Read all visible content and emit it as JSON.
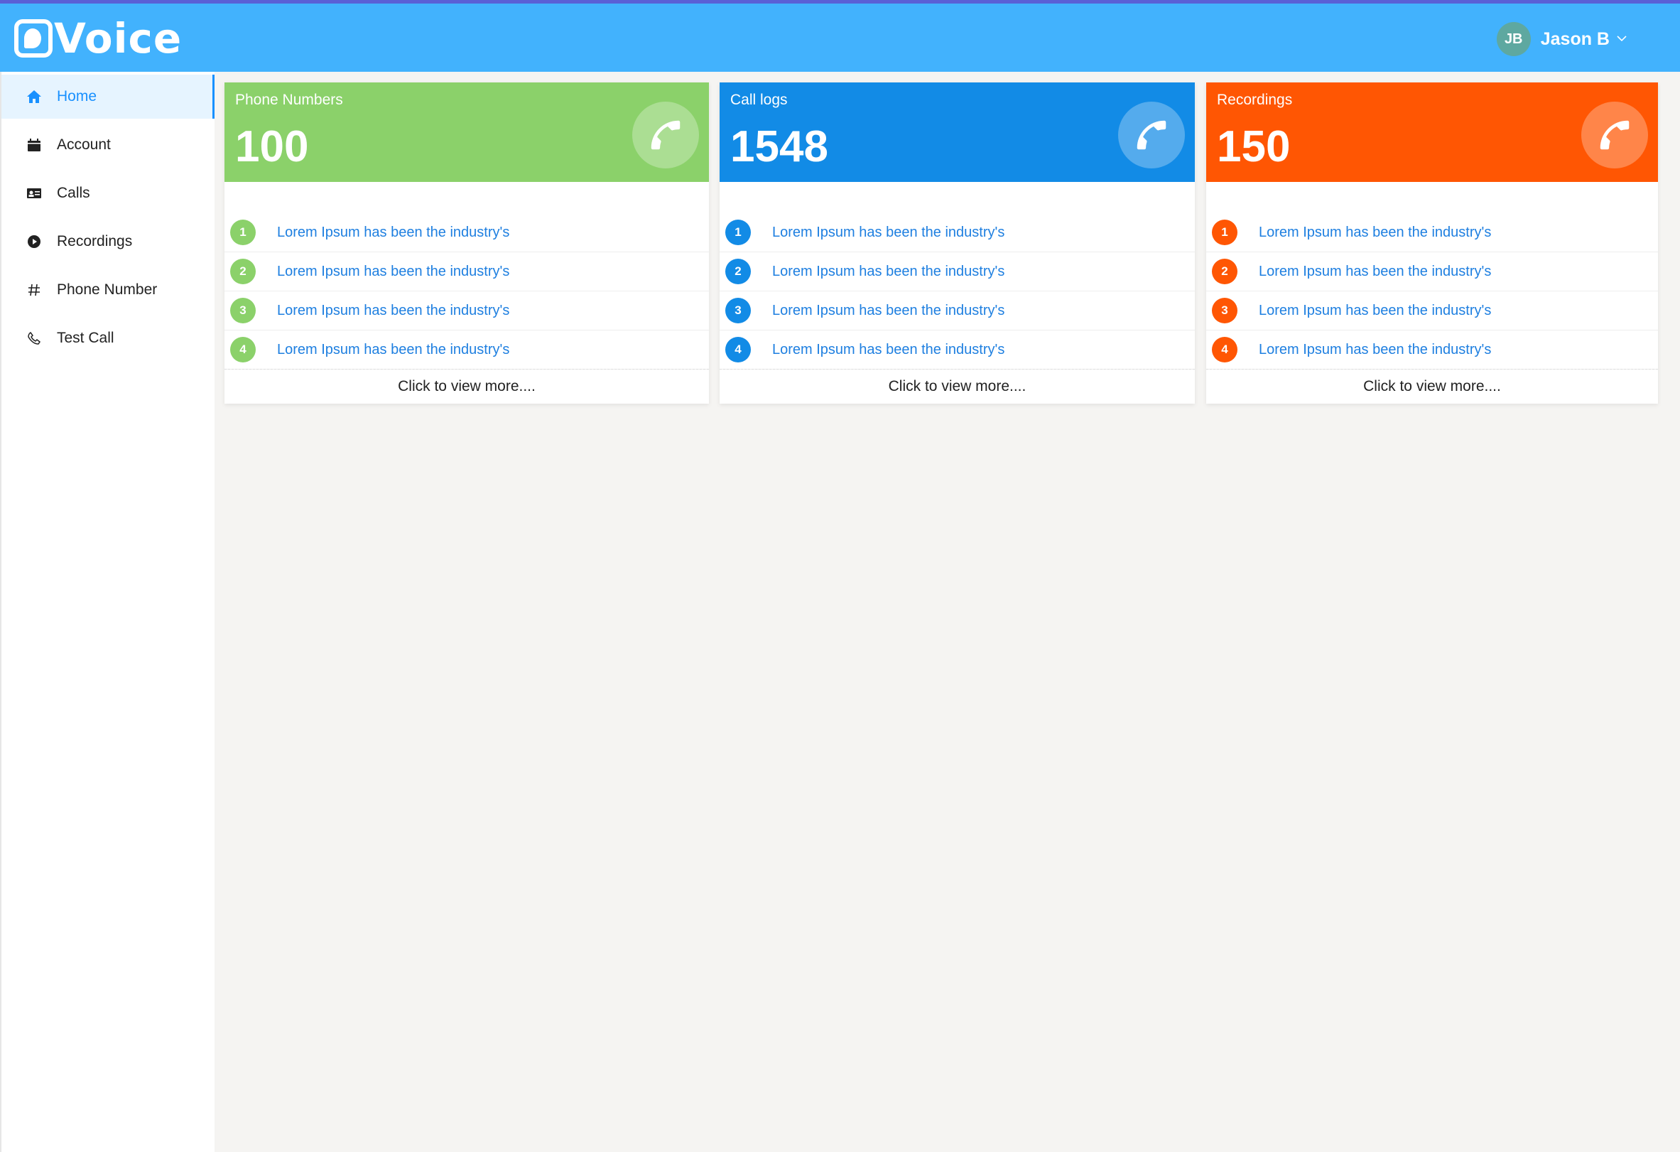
{
  "app": {
    "logo_text": "Voice"
  },
  "header": {
    "user_initials": "JB",
    "user_name": "Jason B",
    "avatar_color": "#5ea8a0",
    "bar_color": "#42b2fd"
  },
  "sidebar": {
    "items": [
      {
        "label": "Home",
        "icon": "home-icon",
        "active": true
      },
      {
        "label": "Account",
        "icon": "calendar-icon"
      },
      {
        "label": "Calls",
        "icon": "contacts-icon"
      },
      {
        "label": "Recordings",
        "icon": "play-circle-icon"
      },
      {
        "label": "Phone Number",
        "icon": "hash-icon"
      },
      {
        "label": "Test Call",
        "icon": "phone-icon"
      }
    ]
  },
  "cards": [
    {
      "title": "Phone Numbers",
      "value": "100",
      "color": "#8bd16a",
      "items": [
        "Lorem Ipsum has been the industry's",
        "Lorem Ipsum has been the industry's",
        "Lorem Ipsum has been the industry's",
        "Lorem Ipsum has been the industry's"
      ],
      "numbers": [
        "1",
        "2",
        "3",
        "4"
      ],
      "more_label": "Click to view more...."
    },
    {
      "title": "Call logs",
      "value": "1548",
      "color": "#128be6",
      "items": [
        "Lorem Ipsum has been the industry's",
        "Lorem Ipsum has been the industry's",
        "Lorem Ipsum has been the industry's",
        "Lorem Ipsum has been the industry's"
      ],
      "numbers": [
        "1",
        "2",
        "3",
        "4"
      ],
      "more_label": "Click to view more...."
    },
    {
      "title": "Recordings",
      "value": "150",
      "color": "#ff5603",
      "items": [
        "Lorem Ipsum has been the industry's",
        "Lorem Ipsum has been the industry's",
        "Lorem Ipsum has been the industry's",
        "Lorem Ipsum has been the industry's"
      ],
      "numbers": [
        "1",
        "2",
        "3",
        "4"
      ],
      "more_label": "Click to view more...."
    }
  ]
}
